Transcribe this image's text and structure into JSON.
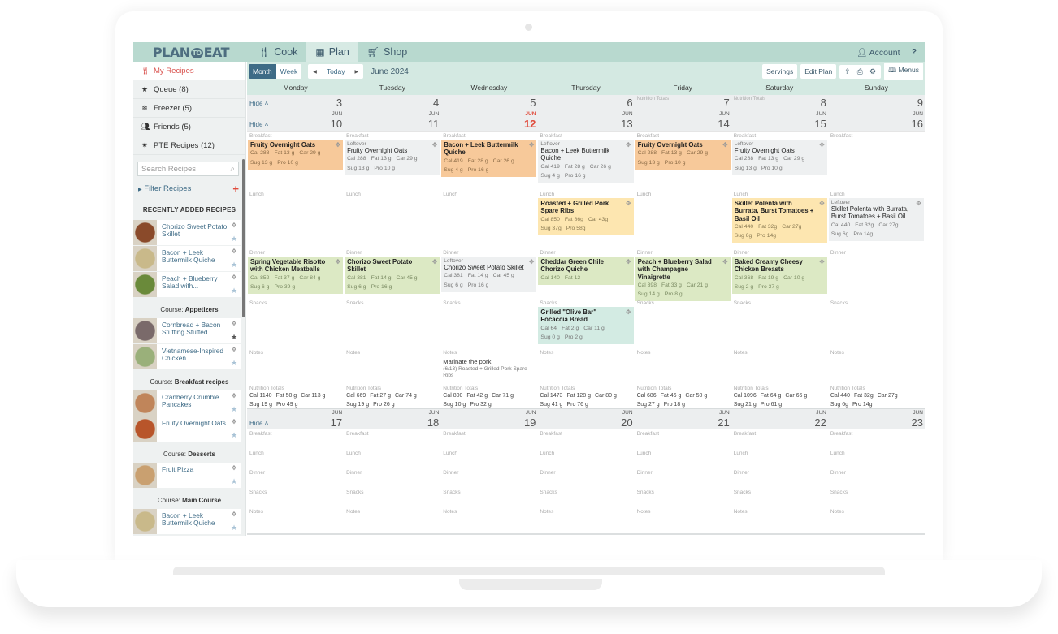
{
  "app": {
    "logo_left": "PLAN",
    "logo_mid": "TO",
    "logo_right": "EAT",
    "nav": [
      {
        "label": "Cook",
        "icon": "utensils-icon"
      },
      {
        "label": "Plan",
        "icon": "calendar-icon",
        "active": true
      },
      {
        "label": "Shop",
        "icon": "cart-icon"
      }
    ],
    "account_label": "Account",
    "help_label": "?"
  },
  "sidebar": {
    "items": [
      {
        "label": "My Recipes",
        "icon": "utensils-icon",
        "active": true
      },
      {
        "label": "Queue (8)",
        "icon": "star-icon"
      },
      {
        "label": "Freezer (5)",
        "icon": "snowflake-icon"
      },
      {
        "label": "Friends (5)",
        "icon": "friends-icon"
      },
      {
        "label": "PTE Recipes (12)",
        "icon": "lightbulb-icon"
      }
    ],
    "search_placeholder": "Search Recipes",
    "filter_label": "Filter Recipes",
    "recent_heading": "RECENTLY ADDED RECIPES",
    "recent": [
      {
        "name": "Chorizo Sweet Potato Skillet",
        "starred": false,
        "thumb": "#8a4a2a"
      },
      {
        "name": "Bacon + Leek Buttermilk Quiche",
        "starred": false,
        "thumb": "#c9b98a"
      },
      {
        "name": "Peach + Blueberry Salad with...",
        "starred": false,
        "thumb": "#6a8a3a"
      }
    ],
    "course_prefix": "Course:",
    "courses": [
      {
        "name": "Appetizers",
        "recipes": [
          {
            "name": "Cornbread + Bacon Stuffing Stuffed...",
            "starred": true,
            "thumb": "#7a6a6a"
          },
          {
            "name": "Vietnamese-Inspired Chicken...",
            "starred": false,
            "thumb": "#9ab07a"
          }
        ]
      },
      {
        "name": "Breakfast recipes",
        "recipes": [
          {
            "name": "Cranberry Crumble Pancakes",
            "starred": false,
            "thumb": "#c0855a"
          },
          {
            "name": "Fruity Overnight Oats",
            "starred": false,
            "thumb": "#b8552a"
          }
        ]
      },
      {
        "name": "Desserts",
        "recipes": [
          {
            "name": "Fruit Pizza",
            "starred": false,
            "thumb": "#c9a070"
          }
        ]
      },
      {
        "name": "Main Course",
        "recipes": [
          {
            "name": "Bacon + Leek Buttermilk Quiche",
            "starred": false,
            "thumb": "#c9b98a"
          }
        ]
      }
    ]
  },
  "toolbar": {
    "month_label": "Month",
    "week_label": "Week",
    "today_label": "Today",
    "current_month": "June 2024",
    "servings_label": "Servings",
    "edit_plan_label": "Edit Plan",
    "menus_label": "Menus"
  },
  "days": [
    "Monday",
    "Tuesday",
    "Wednesday",
    "Thursday",
    "Friday",
    "Saturday",
    "Sunday"
  ],
  "collapsed_week": {
    "hide_label": "Hide",
    "dates": [
      "3",
      "4",
      "5",
      "6",
      "7",
      "8",
      "9"
    ],
    "faint_totals_label": "Nutrition Totals"
  },
  "slot_labels": {
    "breakfast": "Breakfast",
    "lunch": "Lunch",
    "dinner": "Dinner",
    "snacks": "Snacks",
    "notes": "Notes",
    "totals": "Nutrition Totals",
    "leftover": "Leftover"
  },
  "week2": {
    "hide_label": "Hide",
    "month": "JUN",
    "today_index": 2,
    "dates": [
      "10",
      "11",
      "12",
      "13",
      "14",
      "15",
      "16"
    ],
    "columns": [
      {
        "breakfast": [
          {
            "title": "Fruity Overnight Oats",
            "color": "orange",
            "leftover": false,
            "n1": [
              "Cal 288",
              "Fat 13 g",
              "Car 29 g"
            ],
            "n2": [
              "Sug 13 g",
              "Pro 10 g"
            ]
          }
        ],
        "lunch": [],
        "dinner": [
          {
            "title": "Spring Vegetable Risotto with Chicken Meatballs",
            "color": "green",
            "leftover": false,
            "n1": [
              "Cal 852",
              "Fat 37 g",
              "Car 84 g"
            ],
            "n2": [
              "Sug 6 g",
              "Pro 39 g"
            ]
          }
        ],
        "snacks": [],
        "note": null,
        "totals": {
          "n1": [
            "Cal 1140",
            "Fat 50 g",
            "Car 113 g"
          ],
          "n2": [
            "Sug 19 g",
            "Pro 49 g"
          ]
        }
      },
      {
        "breakfast": [
          {
            "title": "Fruity Overnight Oats",
            "color": "gray",
            "leftover": true,
            "n1": [
              "Cal 288",
              "Fat 13 g",
              "Car 29 g"
            ],
            "n2": [
              "Sug 13 g",
              "Pro 10 g"
            ]
          }
        ],
        "lunch": [],
        "dinner": [
          {
            "title": "Chorizo Sweet Potato Skillet",
            "color": "green",
            "leftover": false,
            "n1": [
              "Cal 381",
              "Fat 14 g",
              "Car 45 g"
            ],
            "n2": [
              "Sug 6 g",
              "Pro 16 g"
            ]
          }
        ],
        "snacks": [],
        "note": null,
        "totals": {
          "n1": [
            "Cal 669",
            "Fat 27 g",
            "Car 74 g"
          ],
          "n2": [
            "Sug 19 g",
            "Pro 26 g"
          ]
        }
      },
      {
        "breakfast": [
          {
            "title": "Bacon + Leek Buttermilk Quiche",
            "color": "orange",
            "leftover": false,
            "n1": [
              "Cal 419",
              "Fat 28 g",
              "Car 26 g"
            ],
            "n2": [
              "Sug 4 g",
              "Pro 16 g"
            ]
          }
        ],
        "lunch": [],
        "dinner": [
          {
            "title": "Chorizo Sweet Potato Skillet",
            "color": "gray",
            "leftover": true,
            "n1": [
              "Cal 381",
              "Fat 14 g",
              "Car 45 g"
            ],
            "n2": [
              "Sug 6 g",
              "Pro 16 g"
            ]
          }
        ],
        "snacks": [],
        "note": {
          "text": "Marinate the pork",
          "sub": "(6/13) Roasted + Grilled Pork Spare Ribs"
        },
        "totals": {
          "n1": [
            "Cal 800",
            "Fat 42 g",
            "Car 71 g"
          ],
          "n2": [
            "Sug 10 g",
            "Pro 32 g"
          ]
        }
      },
      {
        "breakfast": [
          {
            "title": "Bacon + Leek Buttermilk Quiche",
            "color": "gray",
            "leftover": true,
            "n1": [
              "Cal 419",
              "Fat 28 g",
              "Car 26 g"
            ],
            "n2": [
              "Sug 4 g",
              "Pro 16 g"
            ]
          }
        ],
        "lunch": [
          {
            "title": "Roasted + Grilled Pork Spare Ribs",
            "color": "yellow",
            "leftover": false,
            "n1": [
              "Cal 850",
              "Fat 86g",
              "Car 43g"
            ],
            "n2": [
              "Sug 37g",
              "Pro 58g"
            ]
          }
        ],
        "dinner": [
          {
            "title": "Cheddar Green Chile Chorizo Quiche",
            "color": "green",
            "leftover": false,
            "n1": [
              "Cal 140",
              "Fat 12"
            ],
            "n2": []
          }
        ],
        "snacks": [
          {
            "title": "Grilled \"Olive Bar\" Focaccia Bread",
            "color": "teal",
            "leftover": false,
            "n1": [
              "Cal 64",
              "Fat 2 g",
              "Car 11 g"
            ],
            "n2": [
              "Sug 0 g",
              "Pro 2 g"
            ]
          }
        ],
        "note": null,
        "totals": {
          "n1": [
            "Cal 1473",
            "Fat 128 g",
            "Car 80 g"
          ],
          "n2": [
            "Sug 41 g",
            "Pro 76 g"
          ]
        }
      },
      {
        "breakfast": [
          {
            "title": "Fruity Overnight Oats",
            "color": "orange",
            "leftover": false,
            "n1": [
              "Cal 288",
              "Fat 13 g",
              "Car 29 g"
            ],
            "n2": [
              "Sug 13 g",
              "Pro 10 g"
            ]
          }
        ],
        "lunch": [],
        "dinner": [
          {
            "title": "Peach + Blueberry Salad with Champagne Vinaigrette",
            "color": "green",
            "leftover": false,
            "n1": [
              "Cal 398",
              "Fat 33 g",
              "Car 21 g"
            ],
            "n2": [
              "Sug 14 g",
              "Pro 8 g"
            ]
          }
        ],
        "snacks": [],
        "note": null,
        "totals": {
          "n1": [
            "Cal 686",
            "Fat 46 g",
            "Car 50 g"
          ],
          "n2": [
            "Sug 27 g",
            "Pro 18 g"
          ]
        }
      },
      {
        "breakfast": [
          {
            "title": "Fruity Overnight Oats",
            "color": "gray",
            "leftover": true,
            "n1": [
              "Cal 288",
              "Fat 13 g",
              "Car 29 g"
            ],
            "n2": [
              "Sug 13 g",
              "Pro 10 g"
            ]
          }
        ],
        "lunch": [
          {
            "title": "Skillet Polenta with Burrata, Burst Tomatoes + Basil Oil",
            "color": "yellow",
            "leftover": false,
            "n1": [
              "Cal 440",
              "Fat 32g",
              "Car 27g"
            ],
            "n2": [
              "Sug 6g",
              "Pro 14g"
            ]
          }
        ],
        "dinner": [
          {
            "title": "Baked Creamy Cheesy Chicken Breasts",
            "color": "green",
            "leftover": false,
            "n1": [
              "Cal 368",
              "Fat 19 g",
              "Car 10 g"
            ],
            "n2": [
              "Sug 2 g",
              "Pro 37 g"
            ]
          }
        ],
        "snacks": [],
        "note": null,
        "totals": {
          "n1": [
            "Cal 1096",
            "Fat 64 g",
            "Car 66 g"
          ],
          "n2": [
            "Sug 21 g",
            "Pro 61 g"
          ]
        }
      },
      {
        "breakfast": [],
        "lunch": [
          {
            "title": "Skillet Polenta with Burrata, Burst Tomatoes + Basil Oil",
            "color": "gray",
            "leftover": true,
            "n1": [
              "Cal 440",
              "Fat 32g",
              "Car 27g"
            ],
            "n2": [
              "Sug 6g",
              "Pro 14g"
            ]
          }
        ],
        "dinner": [],
        "snacks": [],
        "note": null,
        "totals": {
          "n1": [
            "Cal 440",
            "Fat 32g",
            "Car 27g"
          ],
          "n2": [
            "Sug 6g",
            "Pro 14g"
          ]
        }
      }
    ]
  },
  "week3": {
    "hide_label": "Hide",
    "month": "JUN",
    "dates": [
      "17",
      "18",
      "19",
      "20",
      "21",
      "22",
      "23"
    ]
  }
}
